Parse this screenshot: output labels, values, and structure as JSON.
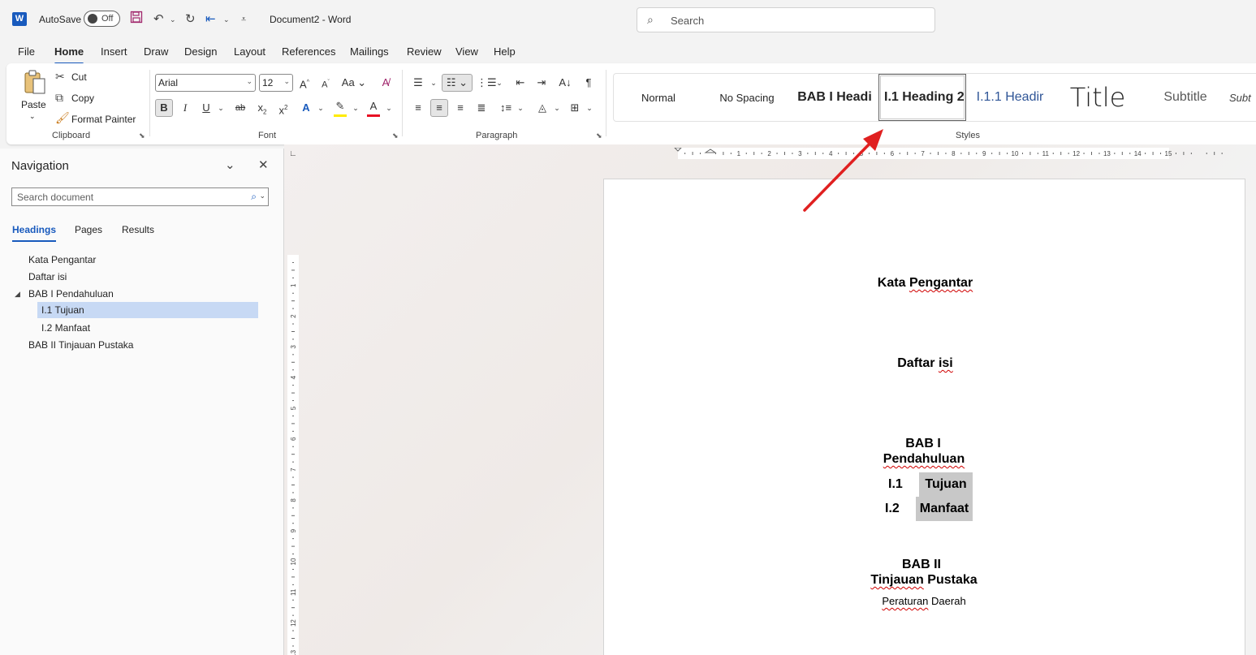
{
  "titlebar": {
    "app_icon": "word-logo-icon",
    "app_letter": "W",
    "autosave_label": "AutoSave",
    "autosave_state": "Off",
    "doc_title": "Document2  -  Word",
    "search_placeholder": "Search"
  },
  "menu": {
    "tabs": [
      "File",
      "Home",
      "Insert",
      "Draw",
      "Design",
      "Layout",
      "References",
      "Mailings",
      "Review",
      "View",
      "Help"
    ],
    "active": "Home"
  },
  "ribbon": {
    "clipboard": {
      "group_label": "Clipboard",
      "paste": "Paste",
      "cut": "Cut",
      "copy": "Copy",
      "format_painter": "Format Painter"
    },
    "font": {
      "group_label": "Font",
      "font_name": "Arial",
      "font_size": "12",
      "font_color": "#e81123",
      "highlight_color": "#ffeb00"
    },
    "paragraph": {
      "group_label": "Paragraph"
    },
    "styles": {
      "group_label": "Styles",
      "items": [
        "Normal",
        "No Spacing",
        "BAB I  Headi",
        "I.1  Heading 2",
        "I.1.1  Headir",
        "Title",
        "Subtitle",
        "Subt"
      ],
      "selected": "I.1  Heading 2"
    }
  },
  "navigation": {
    "title": "Navigation",
    "search_placeholder": "Search document",
    "tabs": [
      "Headings",
      "Pages",
      "Results"
    ],
    "active_tab": "Headings",
    "items": [
      {
        "label": "Kata Pengantar",
        "level": 1
      },
      {
        "label": "Daftar isi",
        "level": 1
      },
      {
        "label": "BAB I  Pendahuluan",
        "level": 1,
        "expanded": true
      },
      {
        "label": "I.1 Tujuan",
        "level": 2,
        "selected": true
      },
      {
        "label": "I.2 Manfaat",
        "level": 2
      },
      {
        "label": "BAB II  Tinjauan Pustaka",
        "level": 1
      }
    ]
  },
  "ruler": {
    "h_numbers": [
      "1",
      "2",
      "3",
      "4",
      "5",
      "6",
      "7",
      "8",
      "9",
      "10",
      "11",
      "12",
      "13",
      "14",
      "15"
    ],
    "v_numbers": [
      "1",
      "2",
      "3",
      "4",
      "5",
      "6",
      "7",
      "8",
      "9",
      "10",
      "11",
      "12",
      "13"
    ]
  },
  "document": {
    "kata_pengantar_1": "Kata",
    "kata_pengantar_2": "Pengantar",
    "daftar_1": "Daftar",
    "daftar_2": "isi",
    "bab1_line1": "BAB I",
    "bab1_line2": "Pendahuluan",
    "h2_1_num": "I.1",
    "h2_1_text": "Tujuan",
    "h2_2_num": "I.2",
    "h2_2_text": "Manfaat",
    "bab2_line1": "BAB II",
    "bab2_line2a": "Tinjauan",
    "bab2_line2b": "Pustaka",
    "body_1": "Peraturan",
    "body_2": "Daerah"
  },
  "annotation": {
    "arrow_color": "#e02020"
  }
}
